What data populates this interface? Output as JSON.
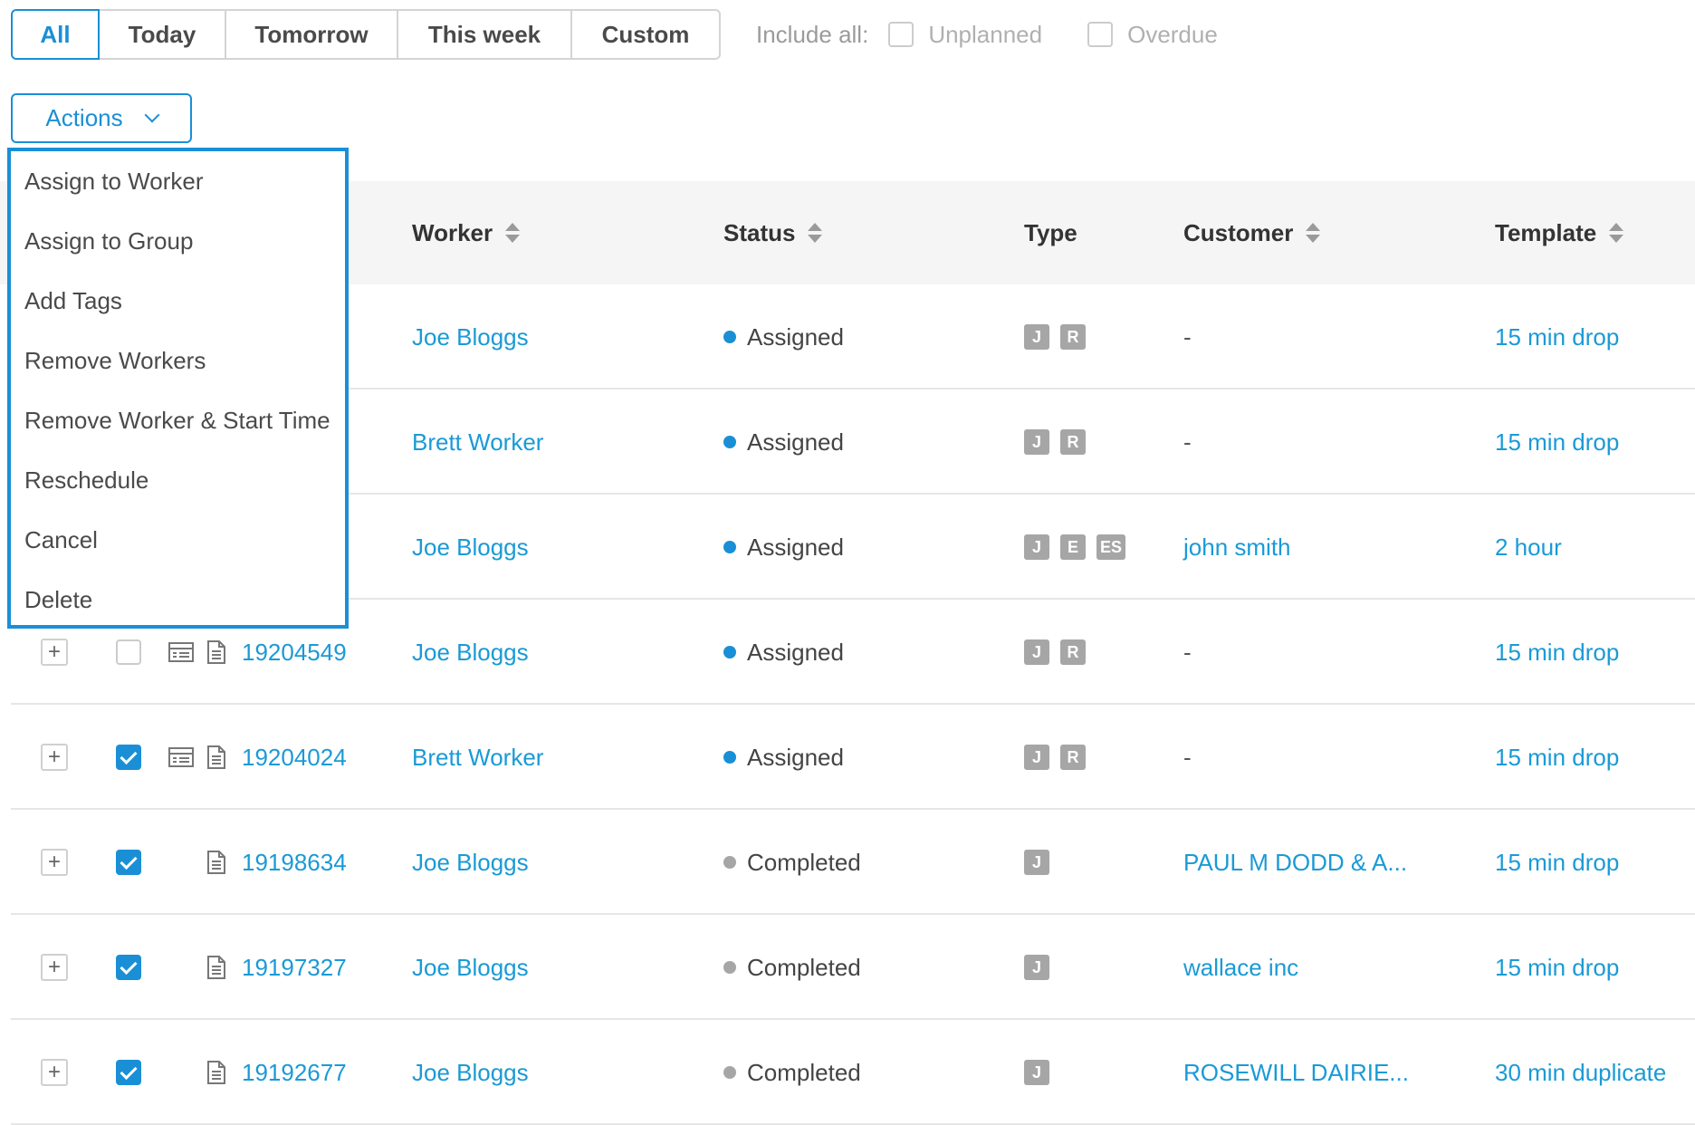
{
  "filters": {
    "tabs": [
      {
        "label": "All",
        "active": true
      },
      {
        "label": "Today",
        "active": false
      },
      {
        "label": "Tomorrow",
        "active": false
      },
      {
        "label": "This week",
        "active": false
      },
      {
        "label": "Custom",
        "active": false
      }
    ],
    "include_label": "Include all:",
    "options": [
      {
        "label": "Unplanned",
        "checked": false
      },
      {
        "label": "Overdue",
        "checked": false
      }
    ]
  },
  "actions": {
    "button_label": "Actions",
    "menu": [
      "Assign to Worker",
      "Assign to Group",
      "Add Tags",
      "Remove Workers",
      "Remove Worker & Start Time",
      "Reschedule",
      "Cancel",
      "Delete"
    ]
  },
  "table": {
    "columns": [
      {
        "label": "Worker",
        "sortable": true
      },
      {
        "label": "Status",
        "sortable": true
      },
      {
        "label": "Type",
        "sortable": false
      },
      {
        "label": "Customer",
        "sortable": true
      },
      {
        "label": "Template",
        "sortable": true
      }
    ],
    "rows": [
      {
        "checked": false,
        "id": "",
        "worker": "Joe Bloggs",
        "status": "Assigned",
        "type": [
          "J",
          "R"
        ],
        "customer": "-",
        "customer_link": false,
        "template": "15 min drop"
      },
      {
        "checked": false,
        "id": "",
        "worker": "Brett Worker",
        "status": "Assigned",
        "type": [
          "J",
          "R"
        ],
        "customer": "-",
        "customer_link": false,
        "template": "15 min drop"
      },
      {
        "checked": false,
        "id": "",
        "worker": "Joe Bloggs",
        "status": "Assigned",
        "type": [
          "J",
          "E",
          "ES"
        ],
        "customer": "john smith",
        "customer_link": true,
        "template": "2 hour"
      },
      {
        "checked": false,
        "id": "19204549",
        "worker": "Joe Bloggs",
        "status": "Assigned",
        "type": [
          "J",
          "R"
        ],
        "customer": "-",
        "customer_link": false,
        "template": "15 min drop",
        "has_card_icon": true
      },
      {
        "checked": true,
        "id": "19204024",
        "worker": "Brett Worker",
        "status": "Assigned",
        "type": [
          "J",
          "R"
        ],
        "customer": "-",
        "customer_link": false,
        "template": "15 min drop",
        "has_card_icon": true
      },
      {
        "checked": true,
        "id": "19198634",
        "worker": "Joe Bloggs",
        "status": "Completed",
        "type": [
          "J"
        ],
        "customer": "PAUL M DODD & A...",
        "customer_link": true,
        "template": "15 min drop",
        "has_card_icon": false
      },
      {
        "checked": true,
        "id": "19197327",
        "worker": "Joe Bloggs",
        "status": "Completed",
        "type": [
          "J"
        ],
        "customer": "wallace inc",
        "customer_link": true,
        "template": "15 min drop",
        "has_card_icon": false
      },
      {
        "checked": true,
        "id": "19192677",
        "worker": "Joe Bloggs",
        "status": "Completed",
        "type": [
          "J"
        ],
        "customer": "ROSEWILL DAIRIE...",
        "customer_link": true,
        "template": "30 min duplicate",
        "has_card_icon": false
      }
    ]
  },
  "colors": {
    "accent": "#1a8fd6",
    "link": "#1a9ad6",
    "assigned_dot": "#1a8fd6",
    "completed_dot": "#a6a6a6",
    "badge": "#a6a6a6"
  },
  "icons": {
    "expand": "plus-icon",
    "card": "card-icon",
    "document": "document-icon",
    "sort": "sort-icon",
    "dropdown": "chevron-down-icon"
  }
}
